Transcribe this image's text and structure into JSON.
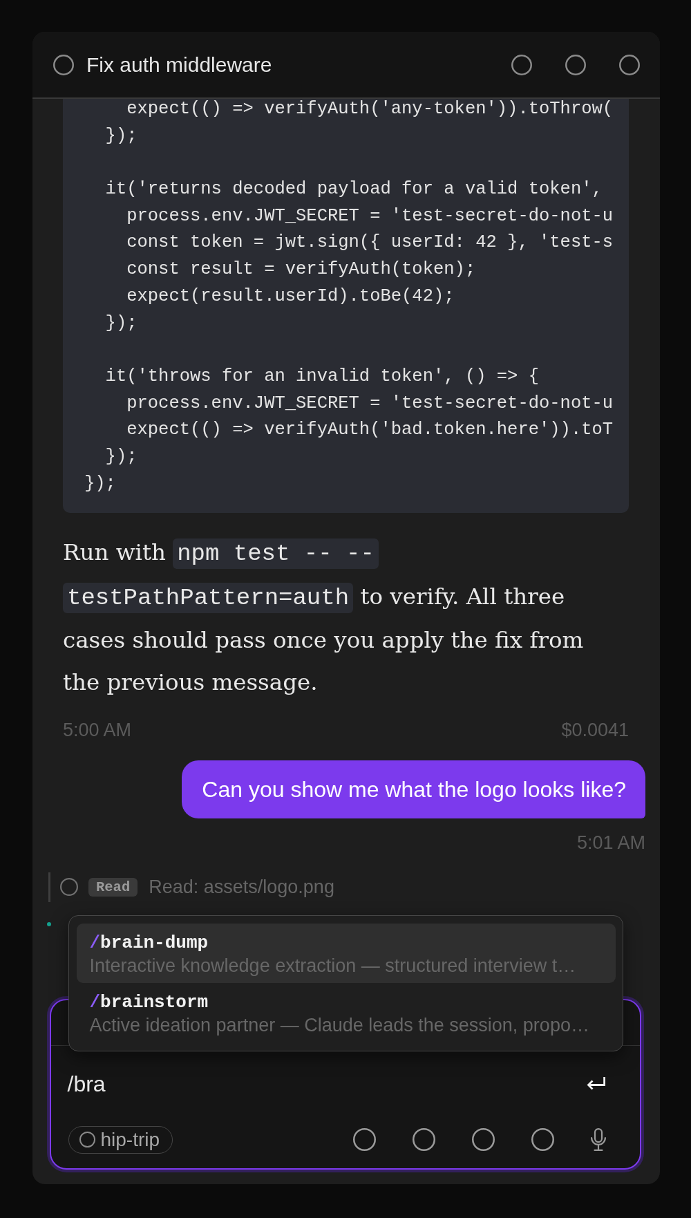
{
  "window": {
    "title": "Fix auth middleware"
  },
  "messages": [
    {
      "kind": "assistant",
      "code_line_groups": [
        [
          "    expect(() => verifyAuth('any-token')).toThrow(",
          "  });"
        ],
        [
          "  it('returns decoded payload for a valid token',",
          "    process.env.JWT_SECRET = 'test-secret-do-not-u",
          "    const token = jwt.sign({ userId: 42 }, 'test-s",
          "    const result = verifyAuth(token);",
          "    expect(result.userId).toBe(42);",
          "  });"
        ],
        [
          "  it('throws for an invalid token', () => {",
          "    process.env.JWT_SECRET = 'test-secret-do-not-u",
          "    expect(() => verifyAuth('bad.token.here')).toT",
          "  });",
          "});"
        ]
      ],
      "text": [
        {
          "kind": "text",
          "text": "Run with "
        },
        {
          "kind": "code",
          "text": "npm test -- --testPathPattern=auth"
        },
        {
          "kind": "text",
          "text": " to verify. All three cases should pass once you apply the fix from the previous message."
        }
      ],
      "time": "5:00 AM",
      "cost": "$0.0041"
    },
    {
      "kind": "user",
      "text": "Can you show me what the logo looks like?",
      "time": "5:01 AM"
    },
    {
      "kind": "tool",
      "badge": "Read",
      "label": "Read: assets/logo.png"
    },
    {
      "kind": "typing"
    }
  ],
  "autocomplete": {
    "items": [
      {
        "command": "/brain-dump",
        "description": "Interactive knowledge extraction — structured interview t…",
        "selected": true
      },
      {
        "command": "/brainstorm",
        "description": "Active ideation partner — Claude leads the session, propo…",
        "selected": false
      }
    ]
  },
  "composer": {
    "value": "/bra",
    "focused": true,
    "context": "hip-trip"
  }
}
